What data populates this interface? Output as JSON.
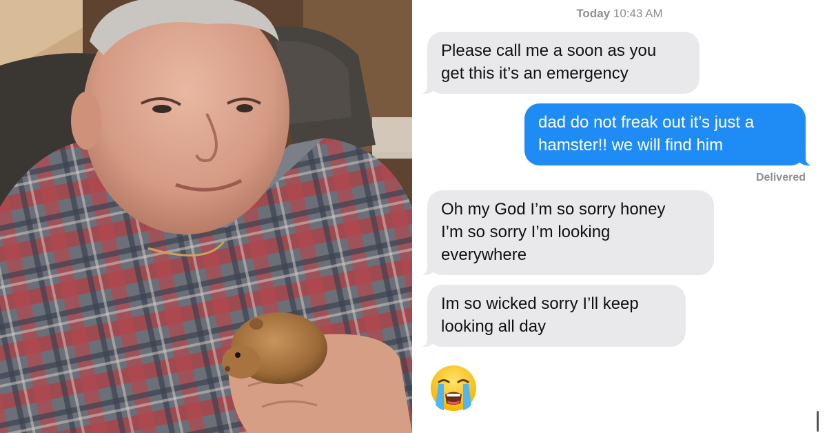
{
  "chat": {
    "timestamp_day": "Today",
    "timestamp_time": "10:43 AM",
    "messages": [
      {
        "direction": "incoming",
        "lines": [
          "Please call me a soon as you",
          "get this it’s an emergency"
        ]
      },
      {
        "direction": "outgoing",
        "lines": [
          "dad do not freak out it’s just a",
          "hamster!! we will find him"
        ]
      },
      {
        "direction": "incoming",
        "lines": [
          "Oh my God I’m so sorry honey",
          "I’m so sorry I’m looking",
          "everywhere"
        ]
      },
      {
        "direction": "incoming",
        "lines": [
          "Im so wicked sorry I’ll keep",
          "looking all day"
        ]
      }
    ],
    "delivered_label": "Delivered",
    "last_emoji": "loudly-crying-face-emoji"
  },
  "colors": {
    "incoming_bubble": "#e9e9eb",
    "outgoing_bubble": "#1f8bf5",
    "meta_text": "#8e8e93"
  },
  "photo": {
    "subject": "man holding a small hamster, wearing red and grey plaid shirt"
  }
}
